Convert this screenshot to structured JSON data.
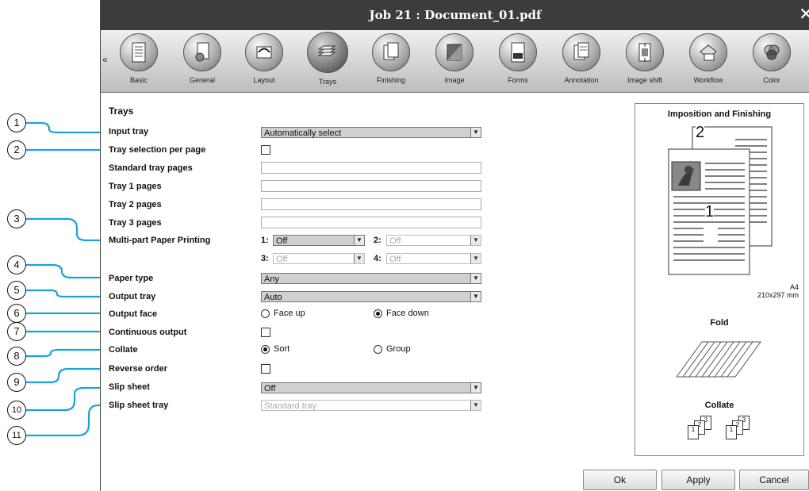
{
  "window": {
    "title": "Job 21 : Document_01.pdf",
    "close_label": "✕"
  },
  "toolbar": {
    "items": [
      {
        "label": "Basic",
        "icon": "basic-icon"
      },
      {
        "label": "General",
        "icon": "general-icon"
      },
      {
        "label": "Layout",
        "icon": "layout-icon"
      },
      {
        "label": "Trays",
        "icon": "trays-icon",
        "active": true
      },
      {
        "label": "Finishing",
        "icon": "finishing-icon"
      },
      {
        "label": "Image",
        "icon": "image-icon"
      },
      {
        "label": "Forms",
        "icon": "forms-icon"
      },
      {
        "label": "Annotation",
        "icon": "annotation-icon"
      },
      {
        "label": "Image shift",
        "icon": "image-shift-icon"
      },
      {
        "label": "Workflow",
        "icon": "workflow-icon"
      },
      {
        "label": "Color",
        "icon": "color-icon"
      }
    ]
  },
  "form": {
    "section_title": "Trays",
    "input_tray": {
      "label": "Input tray",
      "value": "Automatically select"
    },
    "tray_selection": {
      "label": "Tray selection per page"
    },
    "standard_tray_pages": {
      "label": "Standard tray pages",
      "value": ""
    },
    "tray1_pages": {
      "label": "Tray 1 pages",
      "value": ""
    },
    "tray2_pages": {
      "label": "Tray 2 pages",
      "value": ""
    },
    "tray3_pages": {
      "label": "Tray 3 pages",
      "value": ""
    },
    "multipart": {
      "label": "Multi-part Paper Printing",
      "p1_label": "1:",
      "p1_value": "Off",
      "p2_label": "2:",
      "p2_value": "Off",
      "p3_label": "3:",
      "p3_value": "Off",
      "p4_label": "4:",
      "p4_value": "Off"
    },
    "paper_type": {
      "label": "Paper type",
      "value": "Any"
    },
    "output_tray": {
      "label": "Output tray",
      "value": "Auto"
    },
    "output_face": {
      "label": "Output face",
      "opt1": "Face up",
      "opt2": "Face down"
    },
    "continuous_output": {
      "label": "Continuous output"
    },
    "collate": {
      "label": "Collate",
      "opt1": "Sort",
      "opt2": "Group"
    },
    "reverse_order": {
      "label": "Reverse order"
    },
    "slip_sheet": {
      "label": "Slip sheet",
      "value": "Off"
    },
    "slip_sheet_tray": {
      "label": "Slip sheet tray",
      "value": "Standard tray"
    }
  },
  "preview": {
    "title": "Imposition and Finishing",
    "page_front": "1",
    "page_back": "2",
    "size_name": "A4",
    "size_dims": "210x297 mm",
    "fold_title": "Fold",
    "collate_title": "Collate",
    "collate_nums": [
      "1",
      "2",
      "3"
    ]
  },
  "buttons": {
    "ok": "Ok",
    "apply": "Apply",
    "cancel": "Cancel"
  },
  "callouts": [
    "1",
    "2",
    "3",
    "4",
    "5",
    "6",
    "7",
    "8",
    "9",
    "10",
    "11"
  ],
  "colors": {
    "callout_line": "#1aa3d9",
    "titlebar": "#3c3c3c"
  }
}
